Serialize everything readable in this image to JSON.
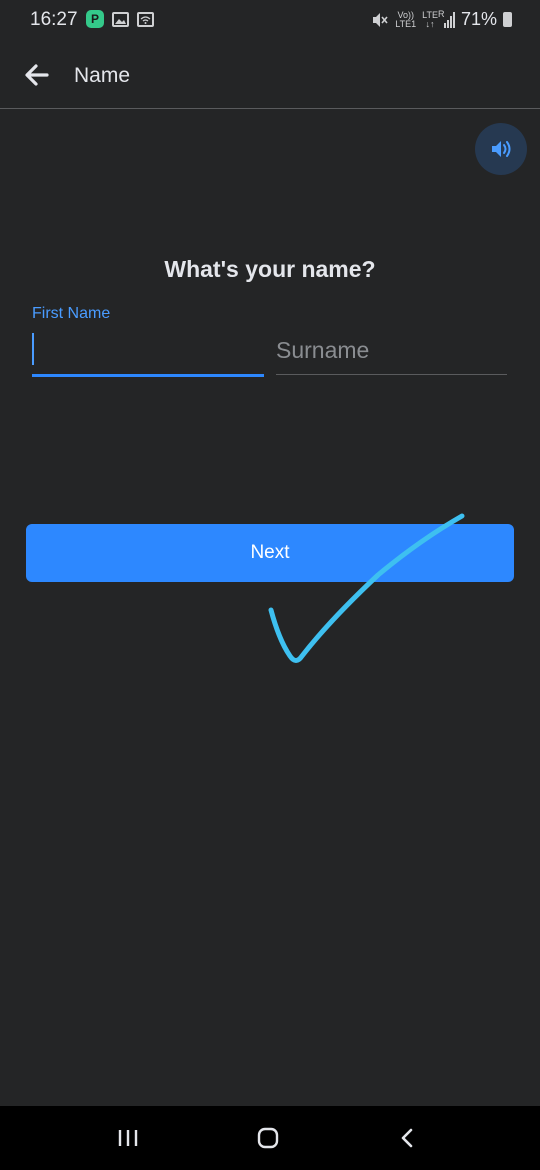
{
  "status_bar": {
    "time": "16:27",
    "app_badge": "P",
    "volte_label": "Vo))",
    "lte1_label": "LTE1",
    "lte_label": "LTE",
    "roaming_label": "R",
    "battery_percent": "71%",
    "icons": [
      "app-notification-icon",
      "gallery-icon",
      "wifi-call-icon",
      "mute-icon",
      "signal-icon",
      "battery-icon"
    ]
  },
  "app_bar": {
    "title": "Name",
    "back_icon": "arrow-left-icon"
  },
  "speaker": {
    "icon": "speaker-icon",
    "accent": "#4a9cff"
  },
  "form": {
    "question": "What's your name?",
    "first_name": {
      "label": "First Name",
      "value": ""
    },
    "surname": {
      "placeholder": "Surname",
      "value": ""
    }
  },
  "next_button": {
    "label": "Next",
    "color": "#2d88ff"
  },
  "annotation": {
    "icon": "checkmark-icon",
    "color": "#3ec0f0"
  },
  "nav_bar": {
    "icons": [
      "recents-icon",
      "home-icon",
      "back-icon"
    ]
  }
}
